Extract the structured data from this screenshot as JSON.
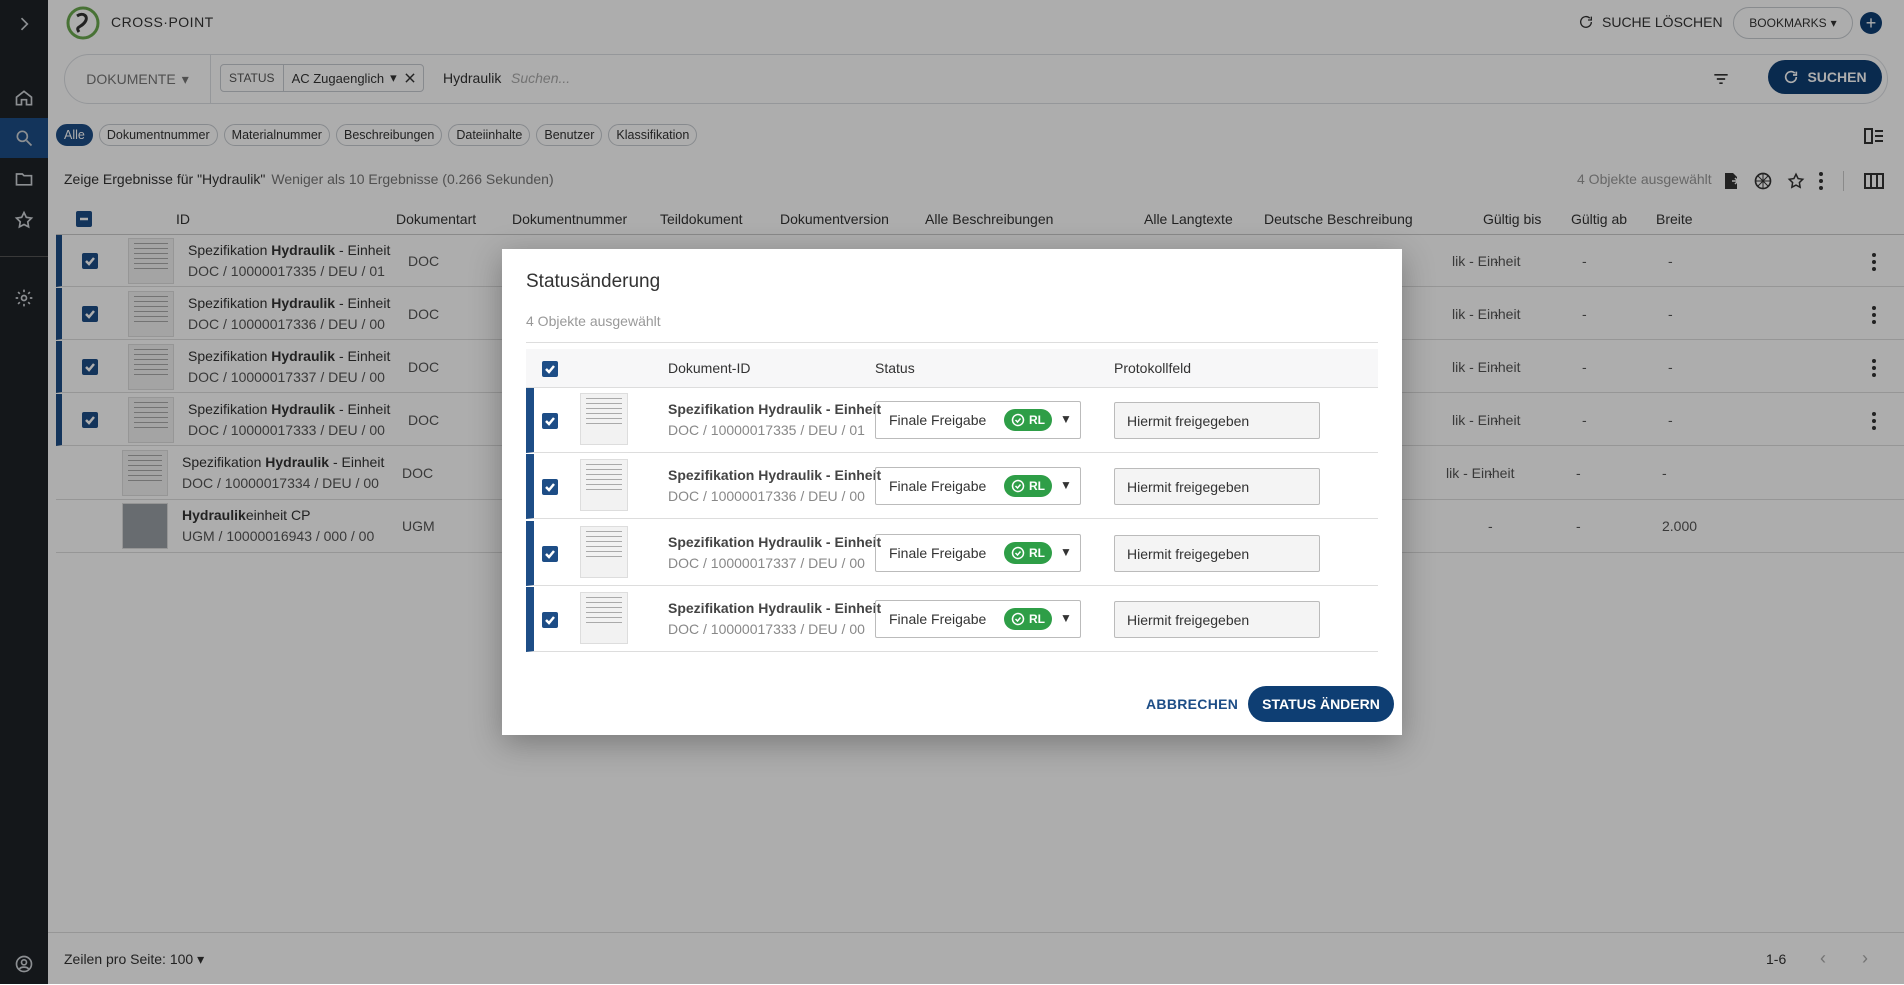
{
  "app": {
    "brand": "CROSS·POINT",
    "reset_label": "SUCHE LÖSCHEN",
    "bookmarks_label": "BOOKMARKS"
  },
  "search": {
    "doc_type": "DOKUMENTE",
    "status_label": "STATUS",
    "status_value": "AC Zugaenglich",
    "query": "Hydraulik",
    "placeholder": "Suchen...",
    "submit_label": "SUCHEN"
  },
  "filters": [
    "Alle",
    "Dokumentnummer",
    "Materialnummer",
    "Beschreibungen",
    "Dateiinhalte",
    "Benutzer",
    "Klassifikation"
  ],
  "results": {
    "heading": "Zeige Ergebnisse für \"Hydraulik\"",
    "summary": "Weniger als 10 Ergebnisse (0.266 Sekunden)",
    "selected": "4 Objekte ausgewählt"
  },
  "table": {
    "columns": [
      "ID",
      "Dokumentart",
      "Dokumentnummer",
      "Teildokument",
      "Dokumentversion",
      "Alle Beschreibungen",
      "Alle Langtexte",
      "Deutsche Beschreibung",
      "Gültig bis",
      "Gültig ab",
      "Breite"
    ],
    "rows": [
      {
        "title_pre": "Spezifikation ",
        "title_bold": "Hydraulik",
        "title_post": " - Einheit",
        "id": "DOC / 10000017335 / DEU / 01",
        "type": "DOC",
        "desc": "lik - Einheit",
        "valid_to": "-",
        "valid_from": "-",
        "width": "-",
        "selected": true
      },
      {
        "title_pre": "Spezifikation ",
        "title_bold": "Hydraulik",
        "title_post": " - Einheit",
        "id": "DOC / 10000017336 / DEU / 00",
        "type": "DOC",
        "desc": "lik - Einheit",
        "valid_to": "-",
        "valid_from": "-",
        "width": "-",
        "selected": true
      },
      {
        "title_pre": "Spezifikation ",
        "title_bold": "Hydraulik",
        "title_post": " - Einheit",
        "id": "DOC / 10000017337 / DEU / 00",
        "type": "DOC",
        "desc": "lik - Einheit",
        "valid_to": "-",
        "valid_from": "-",
        "width": "-",
        "selected": true
      },
      {
        "title_pre": "Spezifikation ",
        "title_bold": "Hydraulik",
        "title_post": " - Einheit",
        "id": "DOC / 10000017333 / DEU / 00",
        "type": "DOC",
        "desc": "lik - Einheit",
        "valid_to": "-",
        "valid_from": "-",
        "width": "-",
        "selected": true
      },
      {
        "title_pre": "Spezifikation ",
        "title_bold": "Hydraulik",
        "title_post": " - Einheit",
        "id": "DOC / 10000017334 / DEU / 00",
        "type": "DOC",
        "desc": "lik - Einheit",
        "valid_to": "-",
        "valid_from": "-",
        "width": "-",
        "selected": false
      },
      {
        "title_pre": "",
        "title_bold": "Hydraulik",
        "title_post": "einheit CP",
        "id": "UGM / 10000016943 / 000 / 00",
        "type": "UGM",
        "desc": "",
        "valid_to": "-",
        "valid_from": "-",
        "width": "2.000",
        "selected": false
      }
    ]
  },
  "footer": {
    "per_page": "Zeilen pro Seite: 100",
    "range": "1-6"
  },
  "dialog": {
    "title": "Statusänderung",
    "subtitle": "4 Objekte ausgewählt",
    "columns": [
      "Dokument-ID",
      "Status",
      "Protokollfeld"
    ],
    "rows": [
      {
        "title": "Spezifikation Hydraulik - Einheit",
        "id": "DOC / 10000017335 / DEU / 01",
        "status": "Finale Freigabe",
        "badge": "RL",
        "note": "Hiermit freigegeben"
      },
      {
        "title": "Spezifikation Hydraulik - Einheit",
        "id": "DOC / 10000017336 / DEU / 00",
        "status": "Finale Freigabe",
        "badge": "RL",
        "note": "Hiermit freigegeben"
      },
      {
        "title": "Spezifikation Hydraulik - Einheit",
        "id": "DOC / 10000017337 / DEU / 00",
        "status": "Finale Freigabe",
        "badge": "RL",
        "note": "Hiermit freigegeben"
      },
      {
        "title": "Spezifikation Hydraulik - Einheit",
        "id": "DOC / 10000017333 / DEU / 00",
        "status": "Finale Freigabe",
        "badge": "RL",
        "note": "Hiermit freigegeben"
      }
    ],
    "cancel_label": "ABBRECHEN",
    "confirm_label": "STATUS ÄNDERN"
  },
  "colors": {
    "accent": "#0e3e73",
    "selection": "#1d4d86",
    "badge": "#2e9e47",
    "sidebar": "#1e2227"
  }
}
